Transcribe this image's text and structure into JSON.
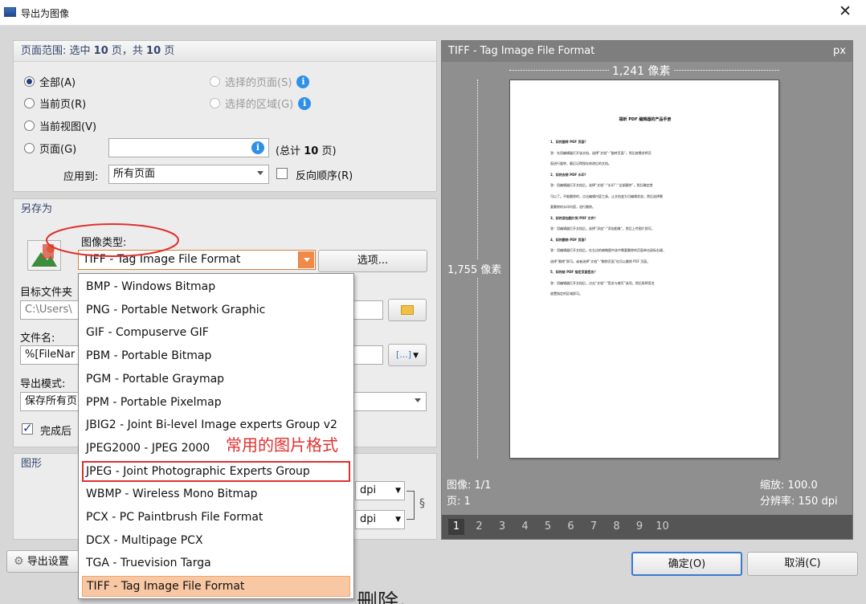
{
  "window": {
    "title": "导出为图像",
    "close_glyph": "✕"
  },
  "page_range": {
    "heading_prefix": "页面范围: 选中",
    "selected_count": "10",
    "heading_mid": "页，共",
    "total_count": "10",
    "heading_suffix": "页",
    "options": {
      "all": "全部(A)",
      "current": "当前页(R)",
      "current_view": "当前视图(V)",
      "pages": "页面(G)",
      "selected_pages": "选择的页面(S)",
      "selected_area": "选择的区域(G)"
    },
    "total_prefix": "(总计",
    "total_pages": "10",
    "total_suffix": "页)",
    "apply_label": "应用到:",
    "apply_value": "所有页面",
    "reverse_label": "反向顺序(R)"
  },
  "save_as": {
    "heading": "另存为",
    "image_type_label": "图像类型:",
    "image_type_value": "TIFF - Tag Image File Format",
    "options_button": "选项...",
    "target_folder_label": "目标文件夹",
    "target_folder_value": "C:\\Users\\",
    "filename_label": "文件名:",
    "filename_value": "%[FileNar",
    "filename_macro_glyph": "[...]",
    "export_mode_label": "导出模式:",
    "export_mode_value": "保存所有页",
    "finish_label": "完成后"
  },
  "graphics": {
    "heading": "图形",
    "dpi_unit": "dpi"
  },
  "dropdown": {
    "items": [
      "BMP - Windows Bitmap",
      "PNG - Portable Network Graphic",
      "GIF - Compuserve GIF",
      "PBM - Portable Bitmap",
      "PGM - Portable Graymap",
      "PPM - Portable Pixelmap",
      "JBIG2 - Joint Bi-level Image experts Group v2",
      "JPEG2000 - JPEG 2000",
      "JPEG - Joint Photographic Experts Group",
      "WBMP - Wireless Mono Bitmap",
      "PCX - PC Paintbrush File Format",
      "DCX - Multipage PCX",
      "TGA - Truevision Targa",
      "TIFF - Tag Image File Format"
    ],
    "highlighted_index": 8,
    "selected_index": 13
  },
  "annotation": {
    "text": "常用的图片格式",
    "color": "#e03030"
  },
  "preview": {
    "header": "TIFF - Tag Image File Format",
    "unit": "px",
    "width_label": "1,241 像素",
    "height_label": "1,755 像素",
    "image_info": "图像: 1/1",
    "page_info": "页: 1",
    "zoom": "缩放: 100.0",
    "resolution": "分辨率: 150 dpi",
    "pages": [
      "1",
      "2",
      "3",
      "4",
      "5",
      "6",
      "7",
      "8",
      "9",
      "10"
    ],
    "active_page": "1",
    "document": {
      "title": "福昕 PDF 编辑器的产品手册",
      "lines": [
        "1、如何旋转 PDF 页面？",
        "答：先用编辑器打开该文档，选择”文档“-”旋转页面“，然后按需求将页",
        "面进行旋转，最后记得保存修改后的文档。",
        "2、如何去除 PDF 水印？",
        "答：用编辑器打开文档后，选择“文档”-“水印”-“全部删除”，然后确定就",
        "可以了。不能删除的，点击编辑内容工具，让文档变为可编辑状态，然后选择需",
        "要删除的水印内容，进行删除。",
        "3、如何添加图片到 PDF 文件？",
        "答：用编辑器打开文档后，选择”添加“-”添加图像“，然后上传图片即可。",
        "4、如何删除 PDF 页面？",
        "答：用编辑器打开文档后，在左边的缩略图中选中需要删除的页面单击鼠标右键，",
        "选择“删除”即可。或者选择“文档”-“删除页面”也可以删除 PDF 页面。",
        "5、如何给 PDF 指定页面签名？",
        "答：用编辑器打开文档后，点击“文档”-“签名与缩写”选项，然后再将签名",
        "放置指定的区域即可。"
      ]
    }
  },
  "footer": {
    "export_settings": "导出设置",
    "ok": "确定(O)",
    "cancel": "取消(C)",
    "background_text": "删除。"
  }
}
